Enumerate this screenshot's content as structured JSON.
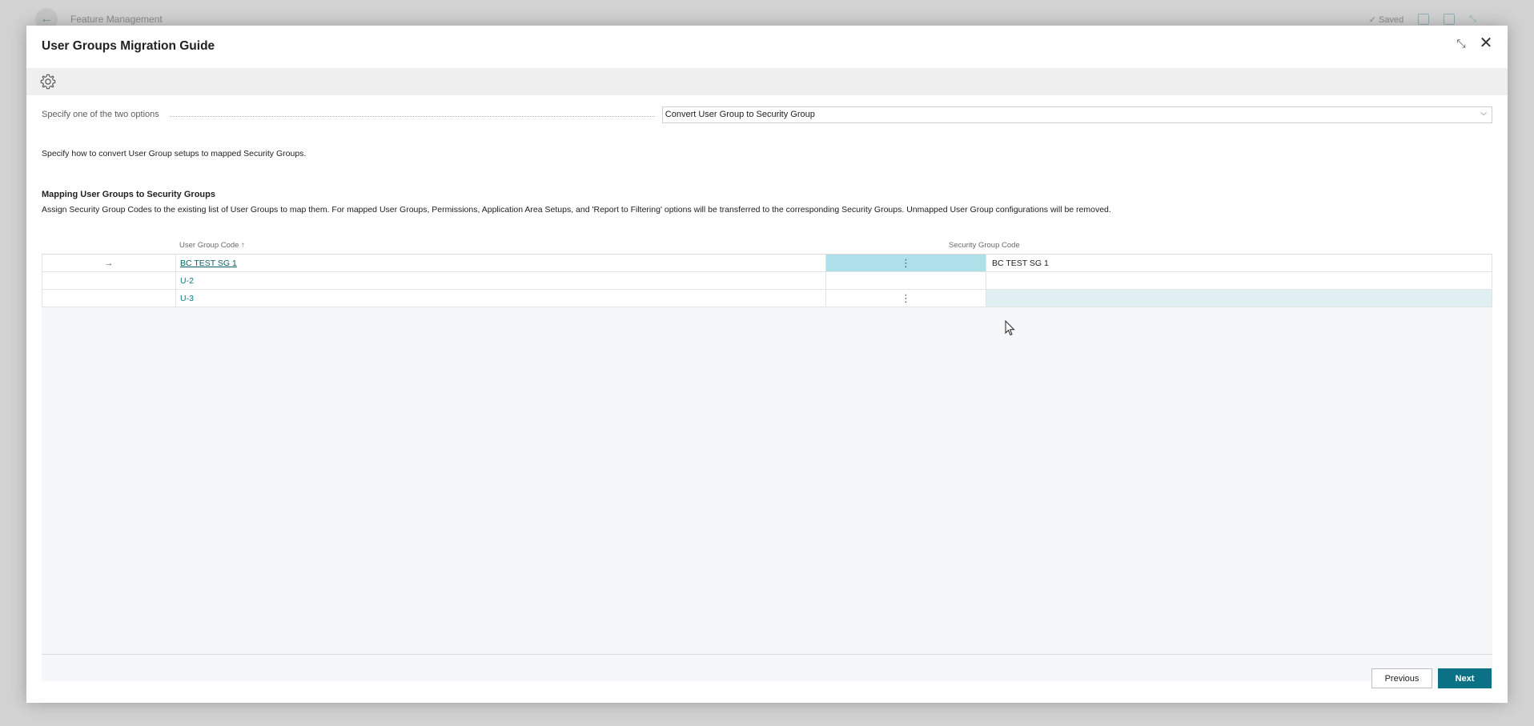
{
  "background": {
    "title": "Feature Management",
    "saved_label": "✓ Saved"
  },
  "dialog": {
    "title": "User Groups Migration Guide",
    "option_label": "Specify one of the two options",
    "option_value": "Convert User Group to Security Group",
    "description": "Specify how to convert User Group setups to mapped Security Groups.",
    "section_title": "Mapping User Groups to Security Groups",
    "section_description": "Assign Security Group Codes to the existing list of User Groups to map them. For mapped User Groups, Permissions, Application Area Setups, and 'Report to Filtering' options will be transferred to the corresponding Security Groups. Unmapped User Group configurations will be removed.",
    "grid": {
      "col_user_group": "User Group Code ↑",
      "col_security_group": "Security Group Code",
      "rows": [
        {
          "arrow": "→",
          "user_group_code": "BC TEST SG 1",
          "menu": "⋮",
          "security_group_code": "BC TEST SG 1"
        },
        {
          "arrow": "",
          "user_group_code": "U-2",
          "menu": "",
          "security_group_code": ""
        },
        {
          "arrow": "",
          "user_group_code": "U-3",
          "menu": "⋮",
          "security_group_code": ""
        }
      ]
    },
    "buttons": {
      "previous": "Previous",
      "next": "Next"
    }
  },
  "colors": {
    "accent": "#0b7286",
    "selected_cell": "#aee0ea",
    "highlight_row": "#e0eff2"
  }
}
